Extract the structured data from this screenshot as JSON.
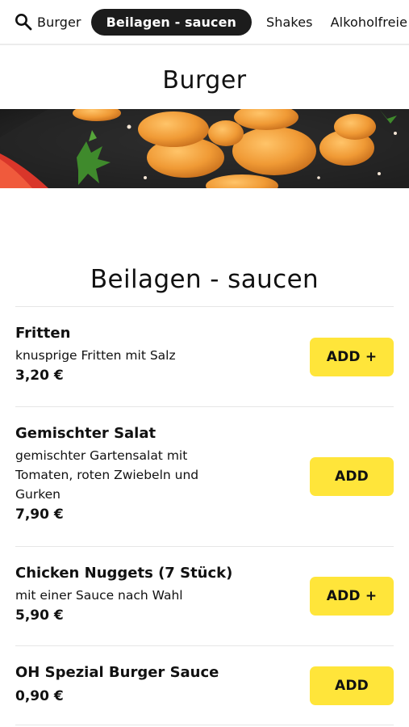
{
  "nav": {
    "tabs": [
      {
        "label": "Burger"
      },
      {
        "label": "Beilagen - saucen",
        "active": true
      },
      {
        "label": "Shakes"
      },
      {
        "label": "Alkoholfreie Getränke"
      }
    ]
  },
  "sections": {
    "burger_title": "Burger",
    "beilagen_title": "Beilagen - saucen"
  },
  "items": [
    {
      "name": "Fritten",
      "description": "knusprige Fritten mit Salz",
      "price": "3,20 €",
      "button": "ADD +"
    },
    {
      "name": "Gemischter Salat",
      "description_lines": [
        "gemischter Gartensalat mit",
        "Tomaten, roten Zwiebeln und",
        "Gurken"
      ],
      "price": "7,90 €",
      "button": "ADD"
    },
    {
      "name": "Chicken Nuggets (7 Stück)",
      "description": "mit einer Sauce nach Wahl",
      "price": "5,90 €",
      "button": "ADD +"
    },
    {
      "name": "OH Spezial Burger Sauce",
      "price": "0,90 €",
      "button": "ADD"
    }
  ],
  "colors": {
    "accent_yellow": "#ffe53a",
    "active_tab_bg": "#1c1c1c",
    "divider": "#e6e6e6"
  },
  "icons": {
    "search": "search-icon"
  }
}
